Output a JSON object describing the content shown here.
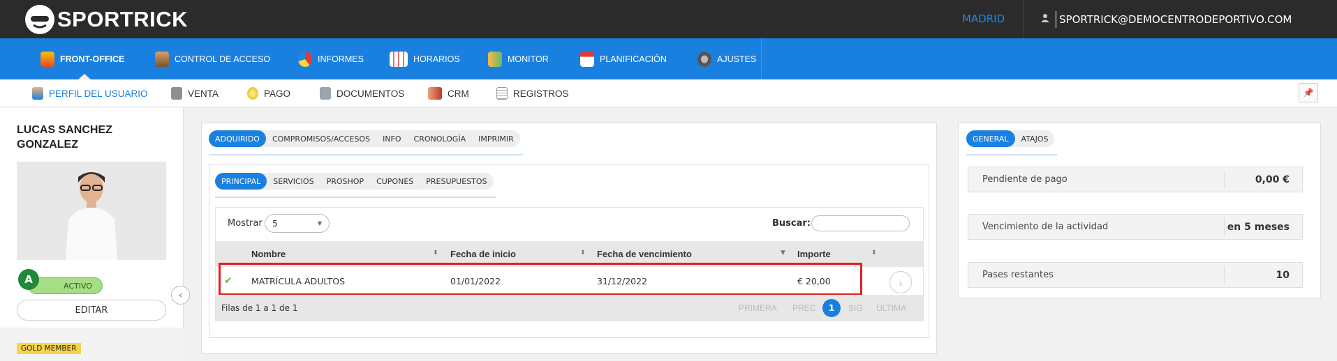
{
  "app": {
    "brand": "SPORTRICK",
    "city": "MADRID",
    "user_email": "SPORTRICK@DEMOCENTRODEPORTIVO.COM"
  },
  "nav": [
    {
      "label": "FRONT-OFFICE",
      "icon": "front-office-icon"
    },
    {
      "label": "CONTROL DE ACCESO",
      "icon": "access-control-icon"
    },
    {
      "label": "INFORMES",
      "icon": "pie-chart-icon"
    },
    {
      "label": "HORARIOS",
      "icon": "calendar-grid-icon"
    },
    {
      "label": "MONITOR",
      "icon": "people-icon"
    },
    {
      "label": "PLANIFICACIÓN",
      "icon": "calendar-icon"
    },
    {
      "label": "AJUSTES",
      "icon": "gear-icon"
    }
  ],
  "subnav": [
    {
      "label": "PERFIL DEL USUARIO",
      "icon": "user-icon"
    },
    {
      "label": "VENTA",
      "icon": "cash-register-icon"
    },
    {
      "label": "PAGO",
      "icon": "coin-icon"
    },
    {
      "label": "DOCUMENTOS",
      "icon": "document-icon"
    },
    {
      "label": "CRM",
      "icon": "handshake-icon"
    },
    {
      "label": "REGISTROS",
      "icon": "notepad-icon"
    }
  ],
  "profile": {
    "name_line1": "LUCAS SANCHEZ",
    "name_line2": "GONZALEZ",
    "badge": "A",
    "status": "ACTIVO",
    "edit": "EDITAR",
    "member": "GOLD MEMBER"
  },
  "main": {
    "tabs1": [
      "ADQUIRIDO",
      "COMPROMISOS/ACCESOS",
      "INFO",
      "CRONOLOGÍA",
      "IMPRIMIR"
    ],
    "tabs2": [
      "PRINCIPAL",
      "SERVICIOS",
      "PROSHOP",
      "CUPONES",
      "PRESUPUESTOS"
    ],
    "show_label": "Mostrar",
    "show_value": "5",
    "search_label": "Buscar:",
    "columns": [
      "Nombre",
      "Fecha de inicio",
      "Fecha de vencimiento",
      "Importe"
    ],
    "row": {
      "nombre": "MATRÍCULA ADULTOS",
      "inicio": "01/01/2022",
      "vencimiento": "31/12/2022",
      "importe": "€ 20,00"
    },
    "footer": "Filas de 1 a 1 de 1",
    "pagination": {
      "first": "PRIMERA",
      "prev": "PREC",
      "current": "1",
      "next": "SIG",
      "last": "ÚLTIMA"
    }
  },
  "right": {
    "tabs": [
      "GENERAL",
      "ATAJOS"
    ],
    "rows": [
      {
        "label": "Pendiente de pago",
        "value": "0,00 €"
      },
      {
        "label": "Vencimiento de la actividad",
        "value": "en 5 meses"
      },
      {
        "label": "Pases restantes",
        "value": "10"
      }
    ]
  },
  "colors": {
    "brand_blue": "#1a80e0",
    "topbar": "#2b2b2b",
    "highlight": "#e02020",
    "active_green": "#a6de86"
  }
}
